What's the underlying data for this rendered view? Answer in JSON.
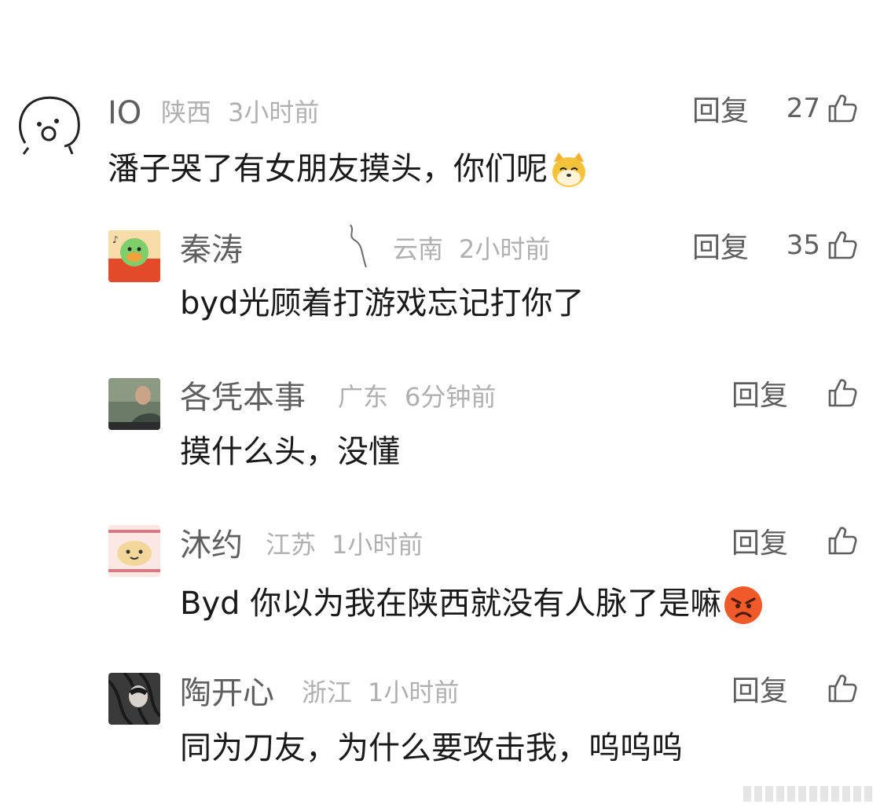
{
  "ui": {
    "reply_label": "回复"
  },
  "comments": [
    {
      "name": "IO",
      "location": "陕西",
      "time": "3小时前",
      "text": "潘子哭了有女朋友摸头，你们呢",
      "likes": "27",
      "emoji": "doge-emoji"
    },
    {
      "name": "秦涛",
      "location": "云南",
      "time": "2小时前",
      "text": "byd光顾着打游戏忘记打你了",
      "likes": "35"
    },
    {
      "name": "各凭本事",
      "location": "广东",
      "time": "6分钟前",
      "text": "摸什么头，没懂",
      "likes": ""
    },
    {
      "name": "沐约",
      "location": "江苏",
      "time": "1小时前",
      "text": "Byd 你以为我在陕西就没有人脉了是嘛",
      "likes": "",
      "emoji": "angry-emoji"
    },
    {
      "name": "陶开心",
      "location": "浙江",
      "time": "1小时前",
      "text": "同为刀友，为什么要攻击我，呜呜呜",
      "likes": ""
    }
  ]
}
